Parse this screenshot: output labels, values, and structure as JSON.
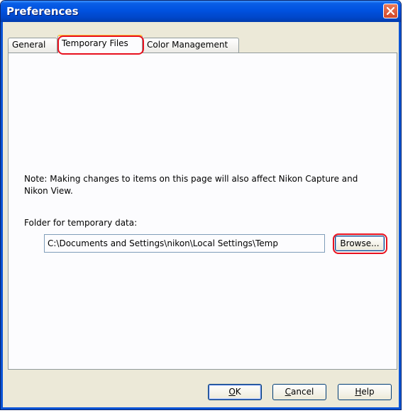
{
  "window": {
    "title": "Preferences"
  },
  "tabs": [
    {
      "label": "General",
      "active": false
    },
    {
      "label": "Temporary Files",
      "active": true
    },
    {
      "label": "Color Management",
      "active": false
    }
  ],
  "panel": {
    "note": "Note: Making changes to items on this page will also affect Nikon Capture and Nikon View.",
    "folder_label": "Folder for temporary data:",
    "folder_value": "C:\\Documents and Settings\\nikon\\Local Settings\\Temp",
    "browse_label": "Browse..."
  },
  "buttons": {
    "ok_prefix": "",
    "ok_underlined": "O",
    "ok_rest": "K",
    "cancel_underlined": "C",
    "cancel_rest": "ancel",
    "help_underlined": "H",
    "help_rest": "elp"
  },
  "colors": {
    "titlebar": "#0052e0",
    "highlight": "#e8101e",
    "active_tab_accent": "#ffc83c"
  },
  "icons": {
    "close": "close-icon"
  }
}
